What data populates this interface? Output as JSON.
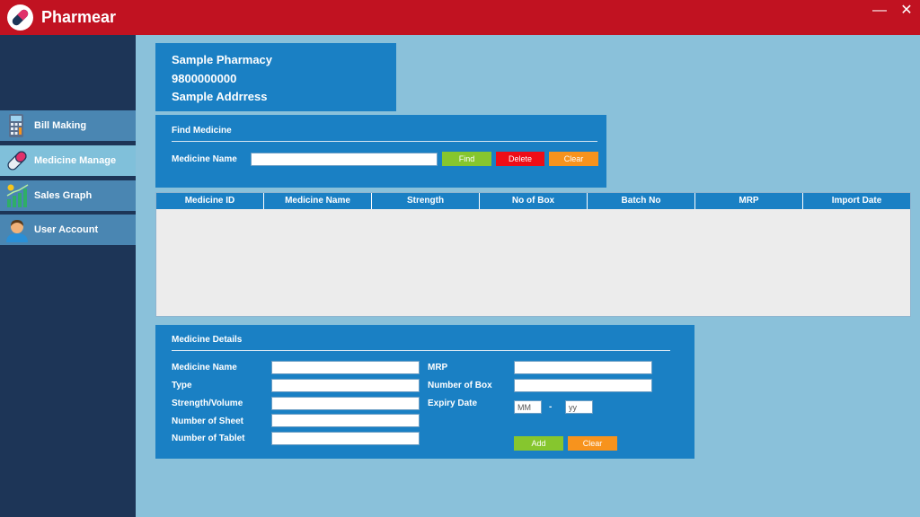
{
  "app": {
    "title": "Pharmear",
    "minimize": "—",
    "close": "✕"
  },
  "sidebar": {
    "items": [
      {
        "label": "Bill Making",
        "icon": "calculator-icon"
      },
      {
        "label": "Medicine Manage",
        "icon": "pill-icon",
        "active": true
      },
      {
        "label": "Sales Graph",
        "icon": "chart-icon"
      },
      {
        "label": "User Account",
        "icon": "user-icon"
      }
    ]
  },
  "pharmacy": {
    "name": "Sample Pharmacy",
    "phone": "9800000000",
    "address": "Sample Addrress"
  },
  "find": {
    "title": "Find Medicine",
    "label": "Medicine Name",
    "input_value": "",
    "find_label": "Find",
    "delete_label": "Delete",
    "clear_label": "Clear"
  },
  "table": {
    "columns": [
      "Medicine ID",
      "Medicine Name",
      "Strength",
      "No of Box",
      "Batch No",
      "MRP",
      "Import Date"
    ],
    "rows": []
  },
  "details": {
    "title": "Medicine Details",
    "fields": {
      "medicine_name": "Medicine Name",
      "type": "Type",
      "strength": "Strength/Volume",
      "sheets": "Number of Sheet",
      "tablets": "Number of Tablet",
      "mrp": "MRP",
      "boxes": "Number of Box",
      "expiry": "Expiry Date"
    },
    "expiry_month_placeholder": "MM",
    "expiry_separator": "-",
    "expiry_year_placeholder": "yy",
    "add_label": "Add",
    "clear_label": "Clear"
  },
  "colors": {
    "titlebar": "#c11221",
    "sidebar": "#1d3557",
    "panel": "#1a80c4",
    "background": "#8ac1da",
    "button_green": "#86c62e",
    "button_red": "#ee0c17",
    "button_orange": "#f7931d"
  }
}
